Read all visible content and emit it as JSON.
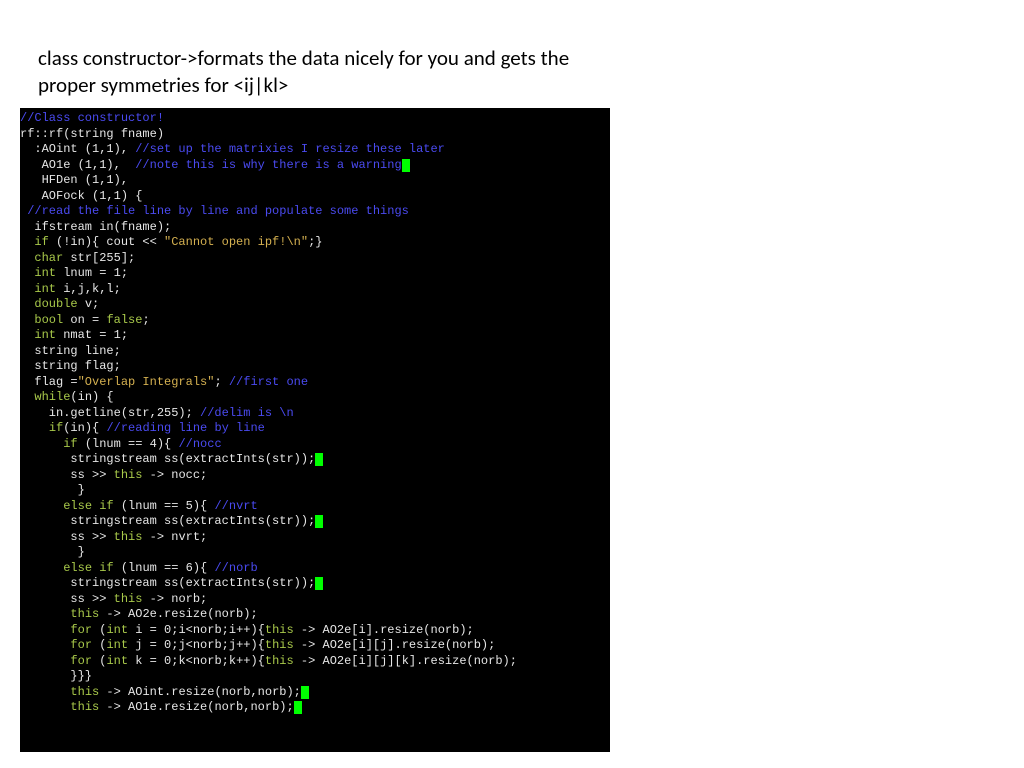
{
  "heading": "class constructor->formats the data nicely for you and gets the proper symmetries  for <ij|kl>",
  "code": {
    "l1": "//Class constructor!",
    "l2a": "rf::rf(string fname)",
    "l3a": "  :AOint (1,1), ",
    "l3b": "//set up the matrixies I resize these later",
    "l4a": "   AO1e (1,1),  ",
    "l4b": "//note this is why there is a warning",
    "l5": "   HFDen (1,1),",
    "l6": "   AOFock (1,1) {",
    "l7": " //read the file line by line and populate some things",
    "l8": "  ifstream in(fname);",
    "l9a": "  ",
    "l9b": "if",
    "l9c": " (!in){ cout << ",
    "l9d": "\"Cannot open ipf!\\n\"",
    "l9e": ";}",
    "l10a": "  ",
    "l10b": "char",
    "l10c": " str[255];",
    "l11a": "  ",
    "l11b": "int",
    "l11c": " lnum = 1;",
    "l12a": "  ",
    "l12b": "int",
    "l12c": " i,j,k,l;",
    "l13a": "  ",
    "l13b": "double",
    "l13c": " v;",
    "l14a": "  ",
    "l14b": "bool",
    "l14c": " on = ",
    "l14d": "false",
    "l14e": ";",
    "l15a": "  ",
    "l15b": "int",
    "l15c": " nmat = 1;",
    "l16": "  string line;",
    "l17": "  string flag;",
    "l18a": "  flag =",
    "l18b": "\"Overlap Integrals\"",
    "l18c": "; ",
    "l18d": "//first one",
    "l19a": "  ",
    "l19b": "while",
    "l19c": "(in) {",
    "l20a": "    in.getline(str,255); ",
    "l20b": "//delim is \\n",
    "l21a": "    ",
    "l21b": "if",
    "l21c": "(in){ ",
    "l21d": "//reading line by line",
    "l22a": "      ",
    "l22b": "if",
    "l22c": " (lnum == 4){ ",
    "l22d": "//nocc",
    "l23": "       stringstream ss(extractInts(str));",
    "l24a": "       ss >> ",
    "l24b": "this",
    "l24c": " -> nocc;",
    "l25": "        }",
    "l26a": "      ",
    "l26b": "else if",
    "l26c": " (lnum == 5){ ",
    "l26d": "//nvrt",
    "l27": "       stringstream ss(extractInts(str));",
    "l28a": "       ss >> ",
    "l28b": "this",
    "l28c": " -> nvrt;",
    "l29": "        }",
    "l30a": "      ",
    "l30b": "else if",
    "l30c": " (lnum == 6){ ",
    "l30d": "//norb",
    "l31": "       stringstream ss(extractInts(str));",
    "l32a": "       ss >> ",
    "l32b": "this",
    "l32c": " -> norb;",
    "l33a": "       ",
    "l33b": "this",
    "l33c": " -> AO2e.resize(norb);",
    "l34a": "       ",
    "l34b": "for",
    "l34c": " (",
    "l34d": "int",
    "l34e": " i = 0;i<norb;i++){",
    "l34f": "this",
    "l34g": " -> AO2e[i].resize(norb);",
    "l35a": "       ",
    "l35b": "for",
    "l35c": " (",
    "l35d": "int",
    "l35e": " j = 0;j<norb;j++){",
    "l35f": "this",
    "l35g": " -> AO2e[i][j].resize(norb);",
    "l36a": "       ",
    "l36b": "for",
    "l36c": " (",
    "l36d": "int",
    "l36e": " k = 0;k<norb;k++){",
    "l36f": "this",
    "l36g": " -> AO2e[i][j][k].resize(norb);",
    "l37": "       }}}",
    "l38a": "       ",
    "l38b": "this",
    "l38c": " -> AOint.resize(norb,norb);",
    "l39a": "       ",
    "l39b": "this",
    "l39c": " -> AO1e.resize(norb,norb);"
  }
}
